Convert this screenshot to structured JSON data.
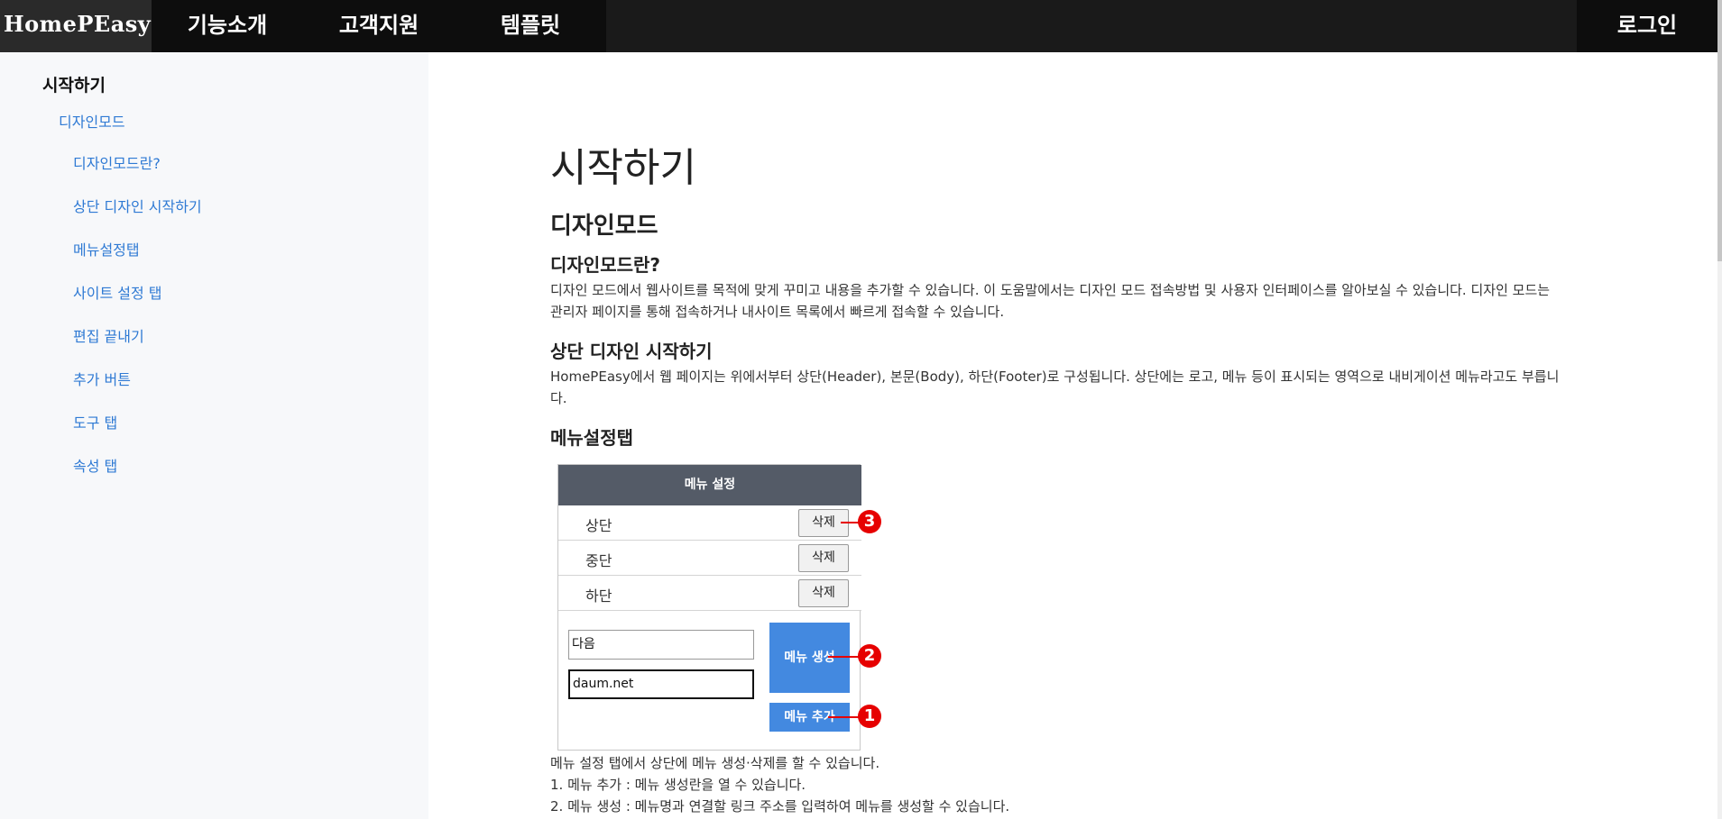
{
  "header": {
    "logo": "HomePEasy",
    "nav": [
      "기능소개",
      "고객지원",
      "템플릿"
    ],
    "login": "로그인"
  },
  "sidebar": {
    "title": "시작하기",
    "section": "디자인모드",
    "items": [
      "디자인모드란?",
      "상단 디자인 시작하기",
      "메뉴설정탭",
      "사이트 설정 탭",
      "편집 끝내기",
      "추가 버튼",
      "도구 탭",
      "속성 탭"
    ]
  },
  "main": {
    "title": "시작하기",
    "section": "디자인모드",
    "s1_title": "디자인모드란?",
    "s1_text": "디자인 모드에서 웹사이트를 목적에 맞게 꾸미고 내용을 추가할 수 있습니다. 이 도움말에서는 디자인 모드 접속방법 및 사용자 인터페이스를 알아보실 수 있습니다. 디자인 모드는 관리자 페이지를 통해 접속하거나 내사이트 목록에서 빠르게 접속할 수 있습니다.",
    "s2_title": "상단 디자인 시작하기",
    "s2_text": "HomePEasy에서 웹 페이지는 위에서부터 상단(Header), 본문(Body), 하단(Footer)로 구성됩니다. 상단에는 로고, 메뉴 등이 표시되는 영역으로 내비게이션 메뉴라고도 부릅니다.",
    "s3_title": "메뉴설정탭",
    "figure": {
      "header": "메뉴 설정",
      "rows": [
        "상단",
        "중단",
        "하단"
      ],
      "delete_label": "삭제",
      "input1": "다음",
      "input2": "daum.net",
      "create_label": "메뉴 생성",
      "add_label": "메뉴 추가",
      "callouts": [
        "3",
        "2",
        "1"
      ]
    },
    "s3_lines": [
      "메뉴 설정 탭에서 상단에 메뉴 생성·삭제를 할 수 있습니다.",
      "1. 메뉴 추가 : 메뉴 생성란을 열 수 있습니다.",
      "2. 메뉴 생성 : 메뉴명과 연결할 링크 주소를 입력하여 메뉴를 생성할 수 있습니다."
    ]
  },
  "colors": {
    "topbar": "#1a1a1a",
    "link": "#2f7ad4",
    "accent_button": "#4389e0",
    "callout": "#e60000"
  }
}
